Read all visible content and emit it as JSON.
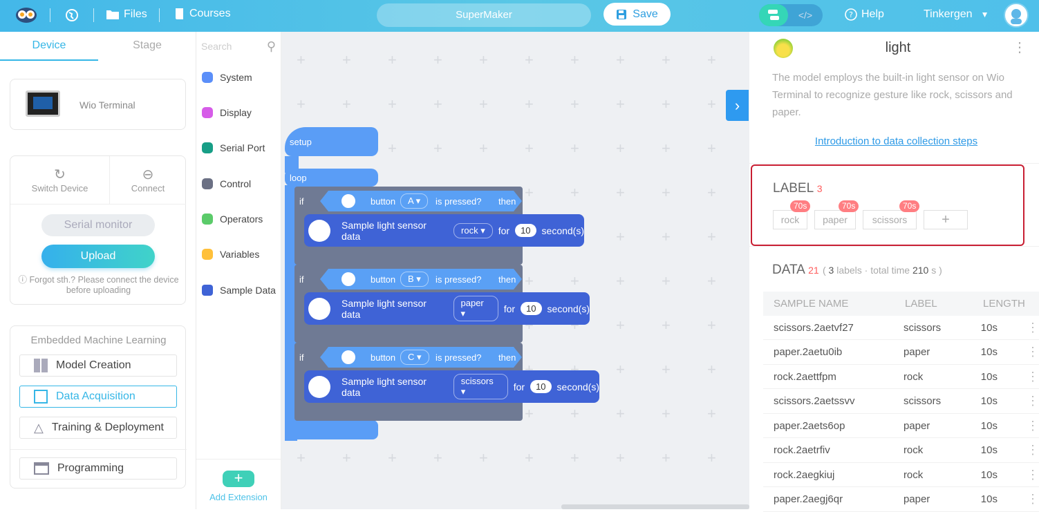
{
  "topbar": {
    "files": "Files",
    "courses": "Courses",
    "project": "SuperMaker",
    "save": "Save",
    "help": "Help",
    "user": "Tinkergen"
  },
  "left": {
    "tab_device": "Device",
    "tab_stage": "Stage",
    "device": "Wio Terminal",
    "switch": "Switch Device",
    "connect": "Connect",
    "serial": "Serial monitor",
    "upload": "Upload",
    "hint": "Forgot sth.? Please connect the device before uploading",
    "eml": "Embedded Machine Learning",
    "items": [
      "Model Creation",
      "Data Acquisition",
      "Training & Deployment"
    ],
    "programming": "Programming"
  },
  "cats": {
    "search": "Search",
    "items": [
      {
        "label": "System",
        "color": "#5b8ff9"
      },
      {
        "label": "Display",
        "color": "#d65ce8"
      },
      {
        "label": "Serial Port",
        "color": "#179e86"
      },
      {
        "label": "Control",
        "color": "#6b7084"
      },
      {
        "label": "Operators",
        "color": "#5bcb6a"
      },
      {
        "label": "Variables",
        "color": "#ffc03a"
      },
      {
        "label": "Sample Data",
        "color": "#3f63d6"
      }
    ],
    "add": "Add Extension"
  },
  "blocks": {
    "setup": "setup",
    "loop": "loop",
    "if": "if",
    "button": "button",
    "pressed": "is pressed?",
    "then": "then",
    "sample": "Sample light sensor data",
    "for": "for",
    "seconds": "second(s)",
    "rows": [
      {
        "btn": "A",
        "label": "rock",
        "sec": "10"
      },
      {
        "btn": "B",
        "label": "paper",
        "sec": "10"
      },
      {
        "btn": "C",
        "label": "scissors",
        "sec": "10"
      }
    ]
  },
  "right": {
    "title": "light",
    "desc": "The model employs the built-in light sensor on Wio Terminal to recognize gesture like rock, scissors and paper.",
    "link": "Introduction to data collection steps",
    "label_title": "LABEL",
    "label_count": "3",
    "labels": [
      {
        "name": "rock",
        "time": "70s"
      },
      {
        "name": "paper",
        "time": "70s"
      },
      {
        "name": "scissors",
        "time": "70s"
      }
    ],
    "add": "+",
    "data_title": "DATA",
    "data_count": "21",
    "data_open": "(",
    "labels_num": "3",
    "labels_word": "labels ·",
    "total_word": "total time",
    "total": "210",
    "total_unit": "s )",
    "cols": [
      "SAMPLE NAME",
      "LABEL",
      "LENGTH"
    ],
    "rows": [
      [
        "scissors.2aetvf27",
        "scissors",
        "10s"
      ],
      [
        "paper.2aetu0ib",
        "paper",
        "10s"
      ],
      [
        "rock.2aettfpm",
        "rock",
        "10s"
      ],
      [
        "scissors.2aetssvv",
        "scissors",
        "10s"
      ],
      [
        "paper.2aets6op",
        "paper",
        "10s"
      ],
      [
        "rock.2aetrfiv",
        "rock",
        "10s"
      ],
      [
        "rock.2aegkiuj",
        "rock",
        "10s"
      ],
      [
        "paper.2aegj6qr",
        "paper",
        "10s"
      ]
    ]
  }
}
